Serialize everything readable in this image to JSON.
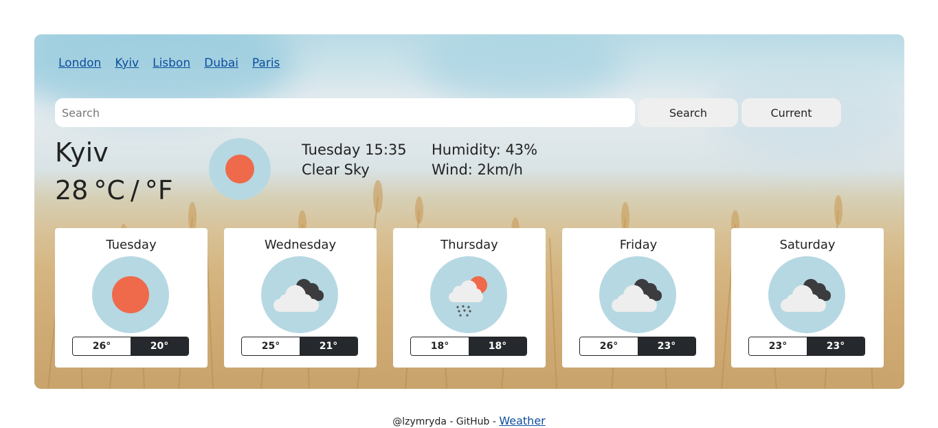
{
  "city_links": [
    "London",
    "Kyiv",
    "Lisbon",
    "Dubai",
    "Paris"
  ],
  "search": {
    "placeholder": "Search",
    "button_label": "Search",
    "current_label": "Current"
  },
  "current": {
    "city": "Kyiv",
    "temperature": "28",
    "unit_c": "°C",
    "separator": "/",
    "unit_f": "°F",
    "datetime": "Tuesday 15:35",
    "description": "Clear Sky",
    "humidity": "Humidity: 43%",
    "wind": "Wind: 2km/h",
    "icon": "sun-icon"
  },
  "forecast": [
    {
      "day": "Tuesday",
      "max": "26°",
      "min": "20°",
      "icon": "sun-icon"
    },
    {
      "day": "Wednesday",
      "max": "25°",
      "min": "21°",
      "icon": "clouds-icon"
    },
    {
      "day": "Thursday",
      "max": "18°",
      "min": "18°",
      "icon": "rain-sun-icon"
    },
    {
      "day": "Friday",
      "max": "26°",
      "min": "23°",
      "icon": "clouds-icon"
    },
    {
      "day": "Saturday",
      "max": "23°",
      "min": "23°",
      "icon": "clouds-icon"
    }
  ],
  "footer": {
    "author": "@lzymryda",
    "dash1": "-",
    "github": "GitHub",
    "dash2": "-",
    "link": "Weather"
  },
  "colors": {
    "icon_bg": "#b6d8e3",
    "sun": "#ee6a4a",
    "link": "#0b4d9c",
    "dark": "#25282c"
  }
}
